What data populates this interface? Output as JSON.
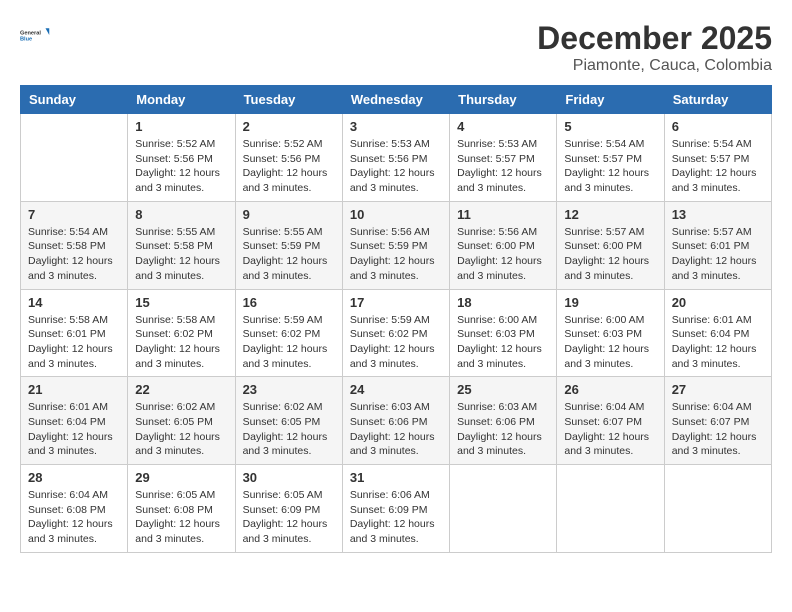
{
  "header": {
    "logo_general": "General",
    "logo_blue": "Blue",
    "month": "December 2025",
    "location": "Piamonte, Cauca, Colombia"
  },
  "weekdays": [
    "Sunday",
    "Monday",
    "Tuesday",
    "Wednesday",
    "Thursday",
    "Friday",
    "Saturday"
  ],
  "weeks": [
    [
      {
        "day": "",
        "sunrise": "",
        "sunset": "",
        "daylight": ""
      },
      {
        "day": "1",
        "sunrise": "Sunrise: 5:52 AM",
        "sunset": "Sunset: 5:56 PM",
        "daylight": "Daylight: 12 hours and 3 minutes."
      },
      {
        "day": "2",
        "sunrise": "Sunrise: 5:52 AM",
        "sunset": "Sunset: 5:56 PM",
        "daylight": "Daylight: 12 hours and 3 minutes."
      },
      {
        "day": "3",
        "sunrise": "Sunrise: 5:53 AM",
        "sunset": "Sunset: 5:56 PM",
        "daylight": "Daylight: 12 hours and 3 minutes."
      },
      {
        "day": "4",
        "sunrise": "Sunrise: 5:53 AM",
        "sunset": "Sunset: 5:57 PM",
        "daylight": "Daylight: 12 hours and 3 minutes."
      },
      {
        "day": "5",
        "sunrise": "Sunrise: 5:54 AM",
        "sunset": "Sunset: 5:57 PM",
        "daylight": "Daylight: 12 hours and 3 minutes."
      },
      {
        "day": "6",
        "sunrise": "Sunrise: 5:54 AM",
        "sunset": "Sunset: 5:57 PM",
        "daylight": "Daylight: 12 hours and 3 minutes."
      }
    ],
    [
      {
        "day": "7",
        "sunrise": "Sunrise: 5:54 AM",
        "sunset": "Sunset: 5:58 PM",
        "daylight": "Daylight: 12 hours and 3 minutes."
      },
      {
        "day": "8",
        "sunrise": "Sunrise: 5:55 AM",
        "sunset": "Sunset: 5:58 PM",
        "daylight": "Daylight: 12 hours and 3 minutes."
      },
      {
        "day": "9",
        "sunrise": "Sunrise: 5:55 AM",
        "sunset": "Sunset: 5:59 PM",
        "daylight": "Daylight: 12 hours and 3 minutes."
      },
      {
        "day": "10",
        "sunrise": "Sunrise: 5:56 AM",
        "sunset": "Sunset: 5:59 PM",
        "daylight": "Daylight: 12 hours and 3 minutes."
      },
      {
        "day": "11",
        "sunrise": "Sunrise: 5:56 AM",
        "sunset": "Sunset: 6:00 PM",
        "daylight": "Daylight: 12 hours and 3 minutes."
      },
      {
        "day": "12",
        "sunrise": "Sunrise: 5:57 AM",
        "sunset": "Sunset: 6:00 PM",
        "daylight": "Daylight: 12 hours and 3 minutes."
      },
      {
        "day": "13",
        "sunrise": "Sunrise: 5:57 AM",
        "sunset": "Sunset: 6:01 PM",
        "daylight": "Daylight: 12 hours and 3 minutes."
      }
    ],
    [
      {
        "day": "14",
        "sunrise": "Sunrise: 5:58 AM",
        "sunset": "Sunset: 6:01 PM",
        "daylight": "Daylight: 12 hours and 3 minutes."
      },
      {
        "day": "15",
        "sunrise": "Sunrise: 5:58 AM",
        "sunset": "Sunset: 6:02 PM",
        "daylight": "Daylight: 12 hours and 3 minutes."
      },
      {
        "day": "16",
        "sunrise": "Sunrise: 5:59 AM",
        "sunset": "Sunset: 6:02 PM",
        "daylight": "Daylight: 12 hours and 3 minutes."
      },
      {
        "day": "17",
        "sunrise": "Sunrise: 5:59 AM",
        "sunset": "Sunset: 6:02 PM",
        "daylight": "Daylight: 12 hours and 3 minutes."
      },
      {
        "day": "18",
        "sunrise": "Sunrise: 6:00 AM",
        "sunset": "Sunset: 6:03 PM",
        "daylight": "Daylight: 12 hours and 3 minutes."
      },
      {
        "day": "19",
        "sunrise": "Sunrise: 6:00 AM",
        "sunset": "Sunset: 6:03 PM",
        "daylight": "Daylight: 12 hours and 3 minutes."
      },
      {
        "day": "20",
        "sunrise": "Sunrise: 6:01 AM",
        "sunset": "Sunset: 6:04 PM",
        "daylight": "Daylight: 12 hours and 3 minutes."
      }
    ],
    [
      {
        "day": "21",
        "sunrise": "Sunrise: 6:01 AM",
        "sunset": "Sunset: 6:04 PM",
        "daylight": "Daylight: 12 hours and 3 minutes."
      },
      {
        "day": "22",
        "sunrise": "Sunrise: 6:02 AM",
        "sunset": "Sunset: 6:05 PM",
        "daylight": "Daylight: 12 hours and 3 minutes."
      },
      {
        "day": "23",
        "sunrise": "Sunrise: 6:02 AM",
        "sunset": "Sunset: 6:05 PM",
        "daylight": "Daylight: 12 hours and 3 minutes."
      },
      {
        "day": "24",
        "sunrise": "Sunrise: 6:03 AM",
        "sunset": "Sunset: 6:06 PM",
        "daylight": "Daylight: 12 hours and 3 minutes."
      },
      {
        "day": "25",
        "sunrise": "Sunrise: 6:03 AM",
        "sunset": "Sunset: 6:06 PM",
        "daylight": "Daylight: 12 hours and 3 minutes."
      },
      {
        "day": "26",
        "sunrise": "Sunrise: 6:04 AM",
        "sunset": "Sunset: 6:07 PM",
        "daylight": "Daylight: 12 hours and 3 minutes."
      },
      {
        "day": "27",
        "sunrise": "Sunrise: 6:04 AM",
        "sunset": "Sunset: 6:07 PM",
        "daylight": "Daylight: 12 hours and 3 minutes."
      }
    ],
    [
      {
        "day": "28",
        "sunrise": "Sunrise: 6:04 AM",
        "sunset": "Sunset: 6:08 PM",
        "daylight": "Daylight: 12 hours and 3 minutes."
      },
      {
        "day": "29",
        "sunrise": "Sunrise: 6:05 AM",
        "sunset": "Sunset: 6:08 PM",
        "daylight": "Daylight: 12 hours and 3 minutes."
      },
      {
        "day": "30",
        "sunrise": "Sunrise: 6:05 AM",
        "sunset": "Sunset: 6:09 PM",
        "daylight": "Daylight: 12 hours and 3 minutes."
      },
      {
        "day": "31",
        "sunrise": "Sunrise: 6:06 AM",
        "sunset": "Sunset: 6:09 PM",
        "daylight": "Daylight: 12 hours and 3 minutes."
      },
      {
        "day": "",
        "sunrise": "",
        "sunset": "",
        "daylight": ""
      },
      {
        "day": "",
        "sunrise": "",
        "sunset": "",
        "daylight": ""
      },
      {
        "day": "",
        "sunrise": "",
        "sunset": "",
        "daylight": ""
      }
    ]
  ]
}
